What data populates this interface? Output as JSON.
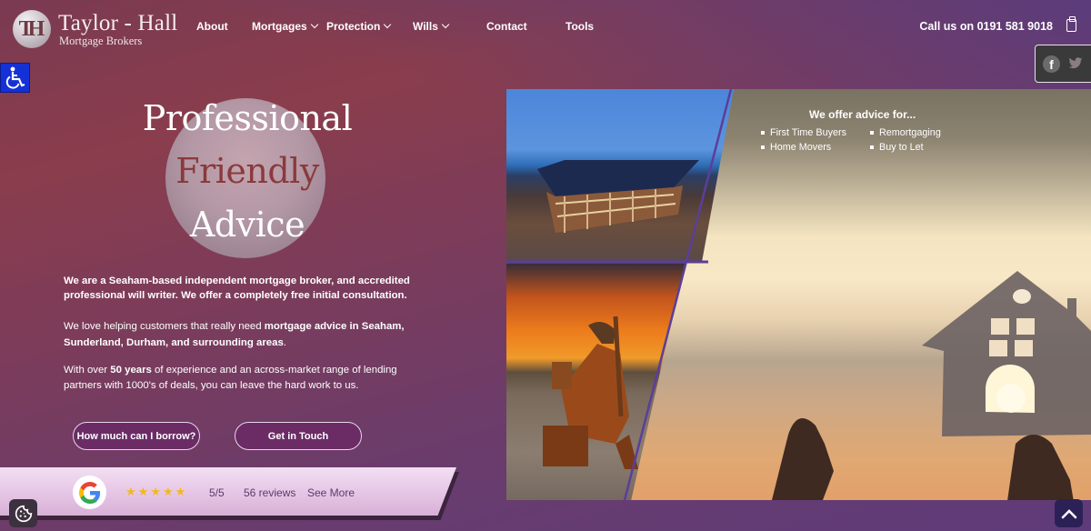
{
  "brand": {
    "monogram": "TH",
    "title": "Taylor - Hall",
    "subtitle": "Mortgage Brokers"
  },
  "nav": {
    "items": [
      {
        "label": "About",
        "has_dropdown": false
      },
      {
        "label": "Mortgages",
        "has_dropdown": true
      },
      {
        "label": "Protection",
        "has_dropdown": true
      },
      {
        "label": "Wills",
        "has_dropdown": true
      },
      {
        "label": "Contact",
        "has_dropdown": false
      },
      {
        "label": "Tools",
        "has_dropdown": false
      }
    ],
    "call_label": "Call us on 0191 581 9018"
  },
  "social": {
    "icons": [
      "facebook-icon",
      "twitter-icon"
    ],
    "facebook_glyph": "f",
    "twitter_glyph": "🐦"
  },
  "hero": {
    "line1": "Professional",
    "line2": "Friendly",
    "line3": "Advice",
    "p1_part1": "We are a Seaham-based independent mortgage broker, and accredited professional will writer. We offer a ",
    "p1_bold": "completely free",
    "p1_part2": " initial consultation.",
    "p2_part1": "We love helping customers that really need ",
    "p2_bold": "mortgage advice in Seaham, Sunderland, Durham, and surrounding areas",
    "p2_part2": ".",
    "p3_part1": "With over ",
    "p3_bold": "50 years",
    "p3_part2": " of experience and an across-market range of lending partners with 1000's of deals, you can leave the hard work to us."
  },
  "buttons": {
    "borrow": "How much can I borrow?",
    "touch": "Get in Touch"
  },
  "reviews": {
    "stars": [
      "★",
      "★",
      "★",
      "★",
      "★"
    ],
    "rating": 5,
    "score": "5/5",
    "count": "56 reviews",
    "see_more": "See More"
  },
  "offer": {
    "title": "We offer advice for...",
    "left": [
      "First Time Buyers",
      "Home Movers"
    ],
    "right": [
      "Remortgaging",
      "Buy to Let"
    ]
  },
  "colors": {
    "button_fill": "#6b2c66",
    "friendly_text": "#8a3a3c",
    "accessibility_blue": "#1431d8",
    "star": "#f3b81d",
    "back_to_top": "#2c2156"
  }
}
